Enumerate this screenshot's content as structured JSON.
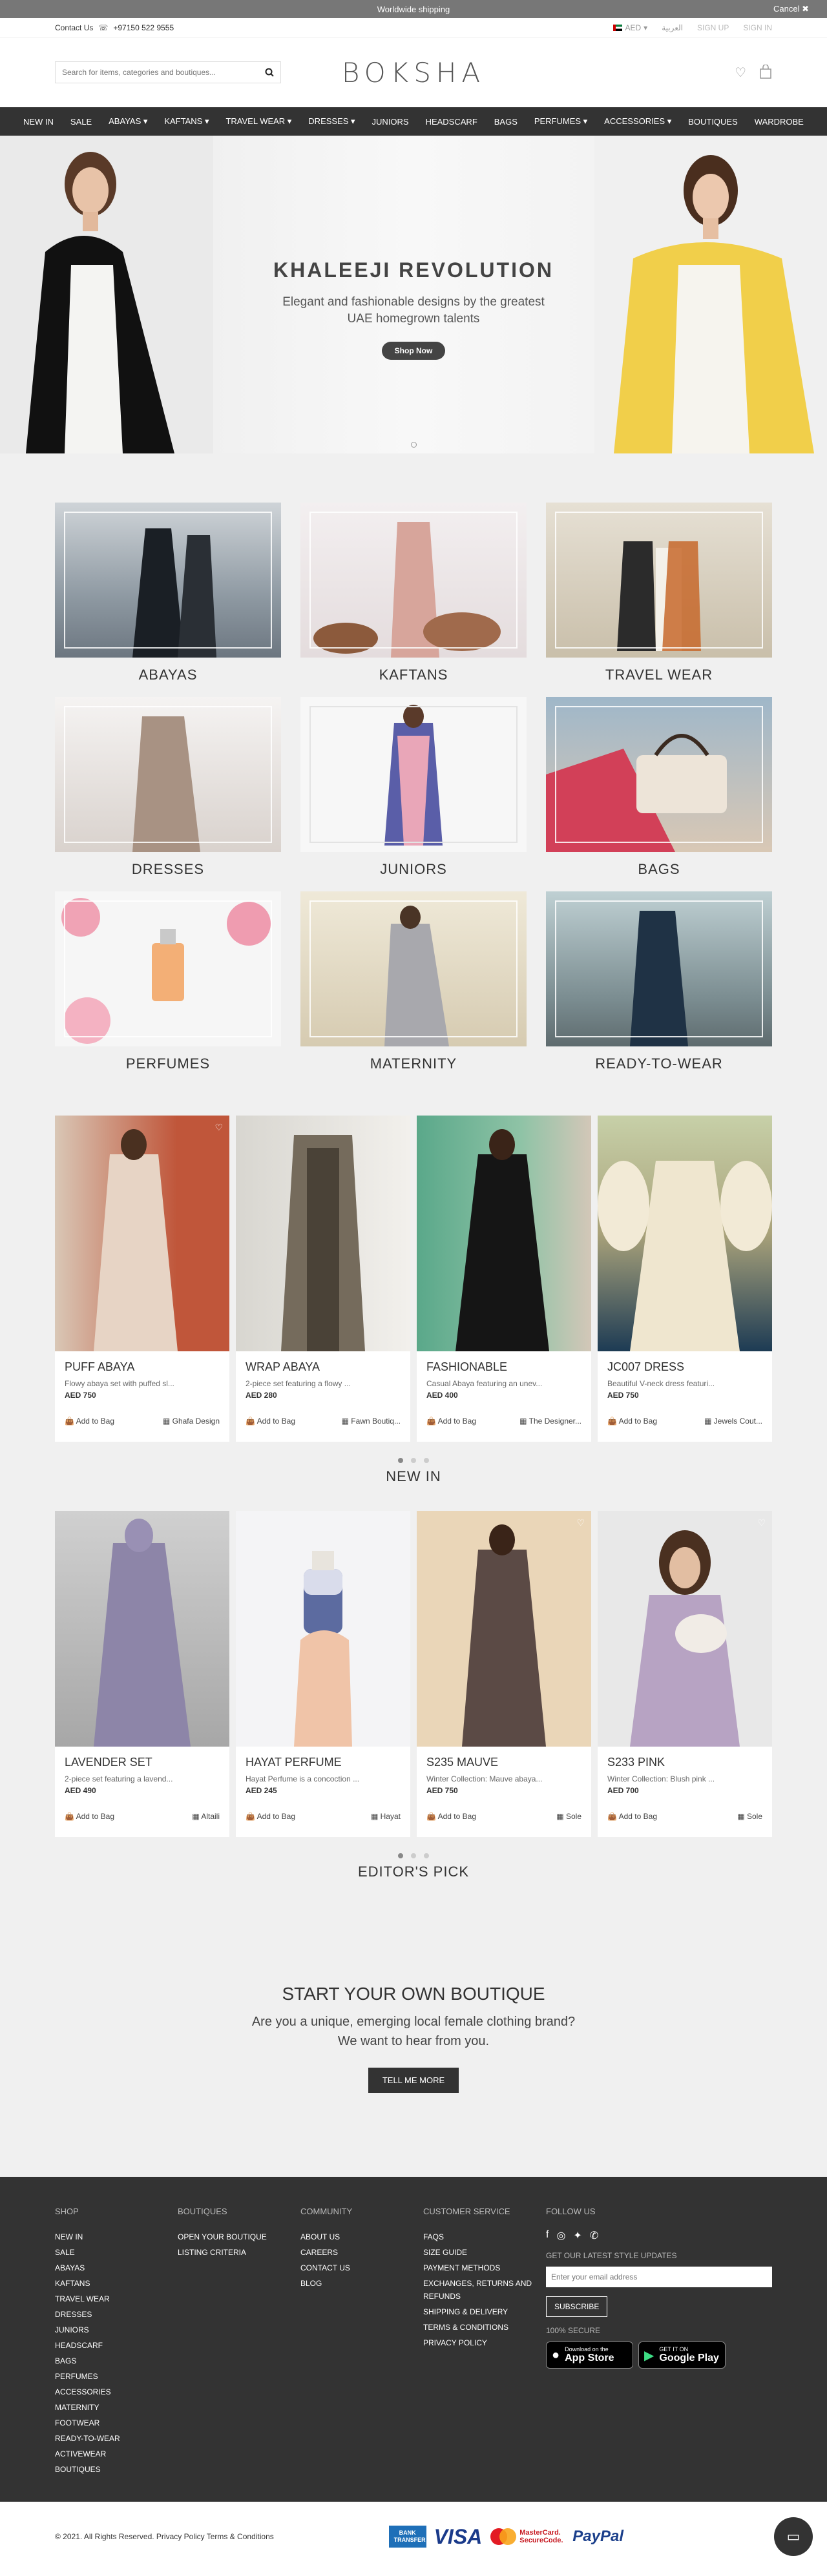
{
  "topbar": {
    "text": "Worldwide shipping",
    "cancel": "Cancel ✖"
  },
  "subheader": {
    "contact": "Contact Us",
    "phone": "+97150 522 9555",
    "currency": "AED",
    "arabic": "العربية",
    "signup": "SIGN UP",
    "signin": "SIGN IN"
  },
  "header": {
    "search_placeholder": "Search for items, categories and boutiques...",
    "logo": "BOKSHA"
  },
  "nav": [
    "NEW IN",
    "SALE",
    "ABAYAS ▾",
    "KAFTANS ▾",
    "TRAVEL WEAR ▾",
    "DRESSES ▾",
    "JUNIORS",
    "HEADSCARF",
    "BAGS",
    "PERFUMES ▾",
    "ACCESSORIES ▾",
    "BOUTIQUES",
    "WARDROBE"
  ],
  "hero": {
    "title": "KHALEEJI REVOLUTION",
    "line1": "Elegant and fashionable designs by the greatest",
    "line2": "UAE homegrown talents",
    "button": "Shop Now"
  },
  "categories": [
    "ABAYAS",
    "KAFTANS",
    "TRAVEL WEAR",
    "DRESSES",
    "JUNIORS",
    "BAGS",
    "PERFUMES",
    "MATERNITY",
    "READY-TO-WEAR"
  ],
  "new_in": {
    "title": "NEW IN",
    "products": [
      {
        "name": "PUFF ABAYA",
        "desc": "Flowy abaya set with puffed sl...",
        "price": "AED 750",
        "add": "Add to Bag",
        "shop": "Ghafa Design"
      },
      {
        "name": "WRAP ABAYA",
        "desc": "2-piece set featuring a flowy ...",
        "price": "AED 280",
        "add": "Add to Bag",
        "shop": "Fawn Boutiq..."
      },
      {
        "name": "FASHIONABLE",
        "desc": "Casual Abaya featuring an unev...",
        "price": "AED 400",
        "add": "Add to Bag",
        "shop": "The Designer..."
      },
      {
        "name": "JC007 DRESS",
        "desc": "Beautiful V-neck dress featuri...",
        "price": "AED 750",
        "add": "Add to Bag",
        "shop": "Jewels Cout..."
      }
    ]
  },
  "editors_pick": {
    "title": "EDITOR'S PICK",
    "products": [
      {
        "name": "LAVENDER SET",
        "desc": "2-piece set featuring a lavend...",
        "price": "AED 490",
        "add": "Add to Bag",
        "shop": "Altaili"
      },
      {
        "name": "HAYAT PERFUME",
        "desc": "Hayat Perfume is a concoction ...",
        "price": "AED 245",
        "add": "Add to Bag",
        "shop": "Hayat"
      },
      {
        "name": "S235 MAUVE",
        "desc": "Winter Collection: Mauve abaya...",
        "price": "AED 750",
        "add": "Add to Bag",
        "shop": "Sole"
      },
      {
        "name": "S233 PINK",
        "desc": "Winter Collection: Blush pink ...",
        "price": "AED 700",
        "add": "Add to Bag",
        "shop": "Sole"
      }
    ]
  },
  "boutique": {
    "title": "START YOUR OWN BOUTIQUE",
    "line1": "Are you a unique, emerging local female clothing brand?",
    "line2": "We want to hear from you.",
    "button": "TELL ME MORE"
  },
  "footer": {
    "shop_title": "SHOP",
    "shop": [
      "NEW IN",
      "SALE",
      "ABAYAS",
      "KAFTANS",
      "TRAVEL WEAR",
      "DRESSES",
      "JUNIORS",
      "HEADSCARF",
      "BAGS",
      "PERFUMES",
      "ACCESSORIES",
      "MATERNITY",
      "FOOTWEAR",
      "READY-TO-WEAR",
      "ACTIVEWEAR",
      "BOUTIQUES"
    ],
    "boutiques_title": "BOUTIQUES",
    "boutiques": [
      "OPEN YOUR BOUTIQUE",
      "LISTING CRITERIA"
    ],
    "community_title": "COMMUNITY",
    "community": [
      "ABOUT US",
      "CAREERS",
      "CONTACT US",
      "BLOG"
    ],
    "cs_title": "CUSTOMER SERVICE",
    "cs": [
      "FAQS",
      "SIZE GUIDE",
      "PAYMENT METHODS",
      "EXCHANGES, RETURNS AND REFUNDS",
      "SHIPPING & DELIVERY",
      "TERMS & CONDITIONS",
      "PRIVACY POLICY"
    ],
    "follow_title": "FOLLOW US",
    "updates": "GET OUR LATEST STYLE UPDATES",
    "email_placeholder": "Enter your email address",
    "subscribe": "SUBSCRIBE",
    "secure": "100% SECURE",
    "appstore_small": "Download on the",
    "appstore": "App Store",
    "gplay_small": "GET IT ON",
    "gplay": "Google Play"
  },
  "bottom": {
    "copyright": "© 2021. All Rights Reserved. Privacy Policy Terms & Conditions",
    "bank": "BANK TRANSFER",
    "visa": "VISA",
    "mc": "MasterCard. SecureCode.",
    "paypal": "PayPal"
  }
}
